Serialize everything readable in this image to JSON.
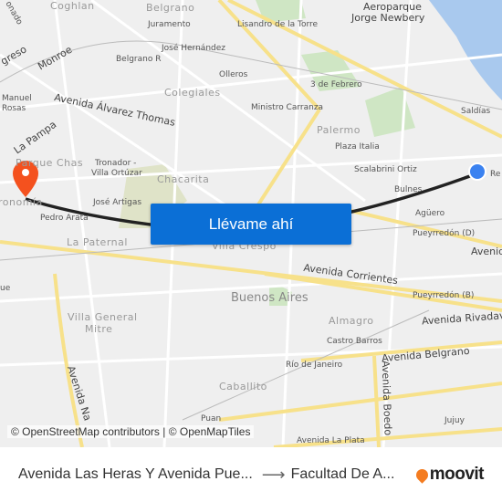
{
  "map": {
    "labels": [
      "onado",
      "Coghlan",
      "Belgrano",
      "Juramento",
      "Lisandro de la Torre",
      "Aeroparque",
      "Jorge Newbery",
      "greso",
      "Monroe",
      "José Hernández",
      "Belgrano R",
      "Olleros",
      "Manuel",
      "Rosas",
      "Colegiales",
      "3 de Febrero",
      "Avenida Álvarez Thomas",
      "Ministro Carranza",
      "Saldías",
      "La Pampa",
      "Palermo",
      "Plaza Italia",
      "Parque Chas",
      "Tronador -",
      "Villa Ortúzar",
      "Chacarita",
      "Scalabrini Ortiz",
      "Re",
      "Bulnes",
      "José Artigas",
      "Pedro Arata",
      "Agüero",
      "ronomía",
      "La Paternal",
      "Villa Crespo",
      "Pueyrredón (D)",
      "Avenida C",
      "Avenida Corrientes",
      "Buenos Aires",
      "Pueyrredón (B)",
      "Almagro",
      "Avenida Rivadavia",
      "Villa General",
      "Mitre",
      "Castro Barros",
      "Avenida Belgrano",
      "Río de Janeiro",
      "Avenida Boedo",
      "Caballito",
      "Avenida Na",
      "Jujuy",
      "Puan",
      "Avenida La Plata",
      "ue"
    ],
    "origin_color": "#3b82f0",
    "destination_color": "#f4511e",
    "route_color": "#222222"
  },
  "cta": {
    "label": "Llévame ahí"
  },
  "attribution": "© OpenStreetMap contributors | © OpenMapTiles",
  "footer": {
    "origin": "Avenida Las Heras Y Avenida Pue...",
    "arrow_icon": "arrow-right-icon",
    "destination": "Facultad De A...",
    "brand": "moovit"
  }
}
